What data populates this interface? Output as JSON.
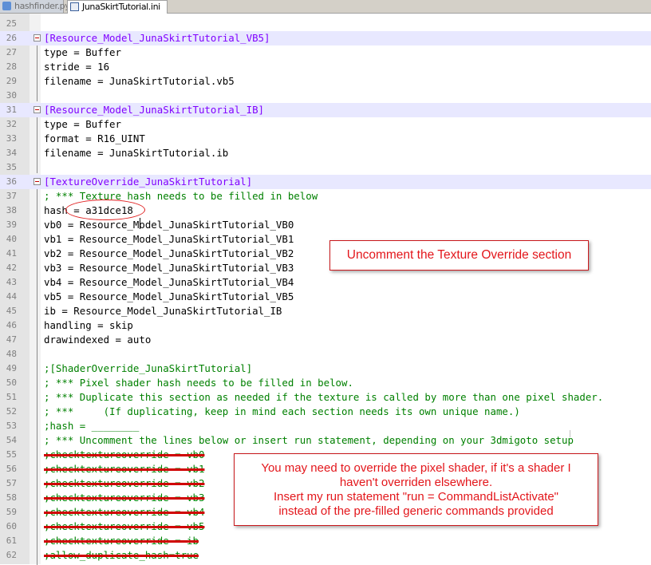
{
  "tabs": [
    {
      "label": "hashfinder.py",
      "active": false
    },
    {
      "label": "JunaSkirtTutorial.ini",
      "active": true
    }
  ],
  "editor": {
    "lines": [
      {
        "num": "25",
        "text": ""
      },
      {
        "num": "26",
        "text": "[Resource_Model_JunaSkirtTutorial_VB5]"
      },
      {
        "num": "27",
        "text": "type = Buffer"
      },
      {
        "num": "28",
        "text": "stride = 16"
      },
      {
        "num": "29",
        "text": "filename = JunaSkirtTutorial.vb5"
      },
      {
        "num": "30",
        "text": ""
      },
      {
        "num": "31",
        "text": "[Resource_Model_JunaSkirtTutorial_IB]"
      },
      {
        "num": "32",
        "text": "type = Buffer"
      },
      {
        "num": "33",
        "text": "format = R16_UINT"
      },
      {
        "num": "34",
        "text": "filename = JunaSkirtTutorial.ib"
      },
      {
        "num": "35",
        "text": ""
      },
      {
        "num": "36",
        "text": "[TextureOverride_JunaSkirtTutorial]"
      },
      {
        "num": "37",
        "text": "; *** Texture hash needs to be filled in below"
      },
      {
        "num": "38",
        "text": "hash = a31dce18"
      },
      {
        "num": "39",
        "text": "vb0 = Resource_Model_JunaSkirtTutorial_VB0"
      },
      {
        "num": "40",
        "text": "vb1 = Resource_Model_JunaSkirtTutorial_VB1"
      },
      {
        "num": "41",
        "text": "vb2 = Resource_Model_JunaSkirtTutorial_VB2"
      },
      {
        "num": "42",
        "text": "vb3 = Resource_Model_JunaSkirtTutorial_VB3"
      },
      {
        "num": "43",
        "text": "vb4 = Resource_Model_JunaSkirtTutorial_VB4"
      },
      {
        "num": "44",
        "text": "vb5 = Resource_Model_JunaSkirtTutorial_VB5"
      },
      {
        "num": "45",
        "text": "ib = Resource_Model_JunaSkirtTutorial_IB"
      },
      {
        "num": "46",
        "text": "handling = skip"
      },
      {
        "num": "47",
        "text": "drawindexed = auto"
      },
      {
        "num": "48",
        "text": ""
      },
      {
        "num": "49",
        "text": ";[ShaderOverride_JunaSkirtTutorial]"
      },
      {
        "num": "50",
        "text": "; *** Pixel shader hash needs to be filled in below."
      },
      {
        "num": "51",
        "text": "; *** Duplicate this section as needed if the texture is called by more than one pixel shader."
      },
      {
        "num": "52",
        "text": "; ***     (If duplicating, keep in mind each section needs its own unique name.)"
      },
      {
        "num": "53",
        "text": ";hash = ________"
      },
      {
        "num": "54",
        "text": "; *** Uncomment the lines below or insert run statement, depending on your 3dmigoto setup"
      },
      {
        "num": "55",
        "text": ";checktextureoverride = vb0"
      },
      {
        "num": "56",
        "text": ";checktextureoverride = vb1"
      },
      {
        "num": "57",
        "text": ";checktextureoverride = vb2"
      },
      {
        "num": "58",
        "text": ";checktextureoverride = vb3"
      },
      {
        "num": "59",
        "text": ";checktextureoverride = vb4"
      },
      {
        "num": "60",
        "text": ";checktextureoverride = vb5"
      },
      {
        "num": "61",
        "text": ";checktextureoverride = ib"
      },
      {
        "num": "62",
        "text": ";allow_duplicate_hash=true"
      }
    ]
  },
  "annotations": {
    "callout_texture": "Uncomment the Texture Override section",
    "callout_shader": [
      "You may need to override the pixel shader, if it's a shader I",
      "haven't overriden elsewhere.",
      "Insert my run statement \"run = CommandListActivate\"",
      "instead of the pre-filled generic commands provided"
    ]
  },
  "colors": {
    "section_header": "#8000ff",
    "section_band": "#e8e8ff",
    "comment": "#008000",
    "annotation_red": "#e3161b"
  }
}
